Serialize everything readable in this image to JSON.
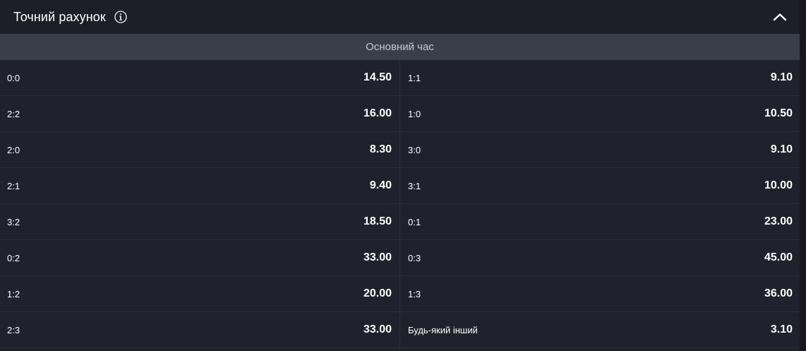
{
  "header": {
    "title": "Точний рахунок"
  },
  "subheader": {
    "label": "Основний час"
  },
  "rows": [
    {
      "left": {
        "label": "0:0",
        "odds": "14.50"
      },
      "right": {
        "label": "1:1",
        "odds": "9.10"
      }
    },
    {
      "left": {
        "label": "2:2",
        "odds": "16.00"
      },
      "right": {
        "label": "1:0",
        "odds": "10.50"
      }
    },
    {
      "left": {
        "label": "2:0",
        "odds": "8.30"
      },
      "right": {
        "label": "3:0",
        "odds": "9.10"
      }
    },
    {
      "left": {
        "label": "2:1",
        "odds": "9.40"
      },
      "right": {
        "label": "3:1",
        "odds": "10.00"
      }
    },
    {
      "left": {
        "label": "3:2",
        "odds": "18.50"
      },
      "right": {
        "label": "0:1",
        "odds": "23.00"
      }
    },
    {
      "left": {
        "label": "0:2",
        "odds": "33.00"
      },
      "right": {
        "label": "0:3",
        "odds": "45.00"
      }
    },
    {
      "left": {
        "label": "1:2",
        "odds": "20.00"
      },
      "right": {
        "label": "1:3",
        "odds": "36.00"
      }
    },
    {
      "left": {
        "label": "2:3",
        "odds": "33.00"
      },
      "right": {
        "label": "Будь-який інший",
        "odds": "3.10"
      }
    }
  ],
  "icons": {
    "info": "info-icon",
    "collapse": "chevron-up-icon"
  },
  "colors": {
    "background": "#1f222c",
    "subheader_bg": "#3a3e49",
    "divider": "#2c303a",
    "text": "#ffffff"
  }
}
